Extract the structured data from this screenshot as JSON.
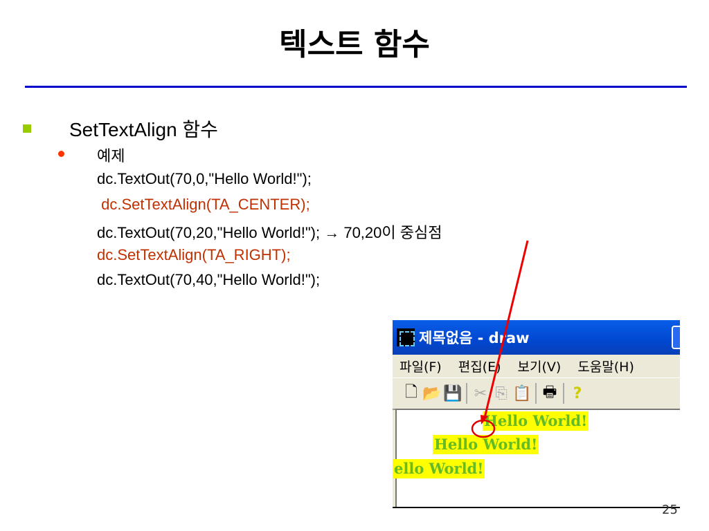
{
  "slide": {
    "title": "텍스트 함수",
    "heading": "SetTextAlign 함수",
    "sub_bullet": "예제",
    "code_lines": [
      "dc.TextOut(70,0,\"Hello World!\");",
      " dc.SetTextAlign(TA_CENTER);",
      "dc.TextOut(70,20,\"Hello World!\"); → 70,20이 중심점",
      "dc.SetTextAlign(TA_RIGHT);",
      "dc.TextOut(70,40,\"Hello World!\");"
    ],
    "page_number": "25",
    "colors": {
      "rule": "#0000cc",
      "highlight_code": "#c03000",
      "bullet_square": "#99cc00",
      "bullet_dot": "#ff3300",
      "arrow": "#ee0000"
    }
  },
  "window": {
    "title": "제목없음 - draw",
    "menu": [
      "파일(F)",
      "편집(E)",
      "보기(V)",
      "도움말(H)"
    ],
    "toolbar_icons": [
      "new-file-icon",
      "open-folder-icon",
      "save-icon",
      "cut-icon",
      "copy-icon",
      "paste-icon",
      "print-icon",
      "help-icon"
    ],
    "outputs": [
      "Hello World!",
      "Hello World!",
      "ello World!"
    ]
  }
}
